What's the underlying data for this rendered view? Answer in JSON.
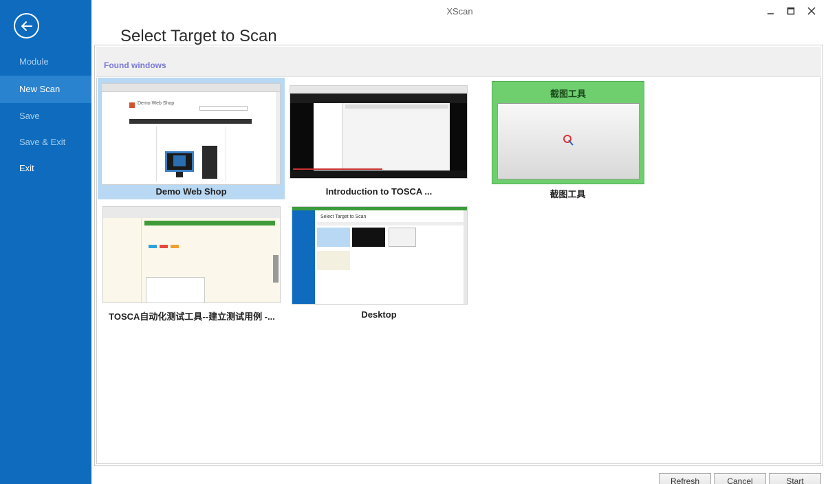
{
  "window": {
    "title": "XScan"
  },
  "page": {
    "heading": "Select Target to Scan"
  },
  "sidebar": {
    "items": [
      {
        "label": "Module"
      },
      {
        "label": "New Scan"
      },
      {
        "label": "Save"
      },
      {
        "label": "Save & Exit"
      },
      {
        "label": "Exit"
      }
    ]
  },
  "panel": {
    "section_label": "Found windows"
  },
  "windows": [
    {
      "label": "Demo Web Shop",
      "thumb_title": "Demo Web Shop"
    },
    {
      "label": "Introduction to TOSCA ..."
    },
    {
      "label": "截图工具",
      "thumb_title": "截图工具"
    },
    {
      "label": "TOSCA自动化测试工具--建立测试用例 -..."
    },
    {
      "label": "Desktop",
      "thumb_title": "Select Target to Scan"
    }
  ],
  "buttons": {
    "refresh": "Refresh",
    "cancel": "Cancel",
    "start": "Start"
  },
  "colors": {
    "sidebar": "#0e6bbd",
    "sidebar_active": "#2a83cf",
    "selection": "#b8d8f3",
    "accent_label": "#7a7ad8"
  }
}
